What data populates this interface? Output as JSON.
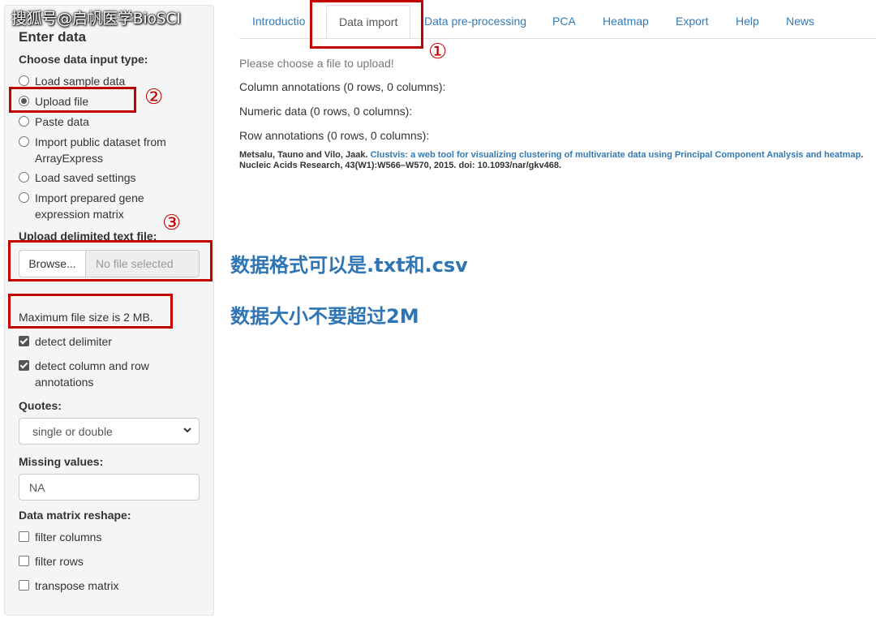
{
  "watermark": "搜狐号@启帆医学BioSCI",
  "sidebar": {
    "title": "Enter data",
    "input_type_label": "Choose data input type:",
    "input_options": [
      {
        "label": "Load sample data",
        "checked": false
      },
      {
        "label": "Upload file",
        "checked": true
      },
      {
        "label": "Paste data",
        "checked": false
      },
      {
        "label": "Import public dataset from ArrayExpress",
        "checked": false
      },
      {
        "label": "Load saved settings",
        "checked": false
      },
      {
        "label": "Import prepared gene expression matrix",
        "checked": false
      }
    ],
    "upload_label": "Upload delimited text file:",
    "browse_button": "Browse...",
    "file_placeholder": "No file selected",
    "max_size_note": "Maximum file size is 2 MB.",
    "detect_delimiter": {
      "label": "detect delimiter",
      "checked": true
    },
    "detect_annotations": {
      "label": "detect column and row annotations",
      "checked": true
    },
    "quotes_label": "Quotes:",
    "quotes_value": "single or double",
    "missing_label": "Missing values:",
    "missing_value": "NA",
    "reshape_label": "Data matrix reshape:",
    "reshape_options": [
      {
        "label": "filter columns",
        "checked": false
      },
      {
        "label": "filter rows",
        "checked": false
      },
      {
        "label": "transpose matrix",
        "checked": false
      }
    ]
  },
  "tabs": [
    {
      "label": "Introductio"
    },
    {
      "label": "Data import",
      "active": true
    },
    {
      "label": "Data pre-processing"
    },
    {
      "label": "PCA"
    },
    {
      "label": "Heatmap"
    },
    {
      "label": "Export"
    },
    {
      "label": "Help"
    },
    {
      "label": "News"
    }
  ],
  "main": {
    "choose_file": "Please choose a file to upload!",
    "column_annotations": "Column annotations (0 rows, 0 columns):",
    "numeric_data": "Numeric data (0 rows, 0 columns):",
    "row_annotations": "Row annotations (0 rows, 0 columns):",
    "citation_authors": "Metsalu, Tauno and Vilo, Jaak.",
    "citation_title": "Clustvis: a web tool for visualizing clustering of multivariate data using Principal Component Analysis and heatmap",
    "citation_rest": ". Nucleic Acids Research, 43(W1):W566–W570, 2015. doi: 10.1093/nar/gkv468."
  },
  "annotations": {
    "marker_1": "①",
    "marker_2": "②",
    "marker_3": "③",
    "note_format": "数据格式可以是.txt和.csv",
    "note_size": "数据大小不要超过2M",
    "box_color": "#c00000",
    "note_color": "#2e75b6"
  },
  "colors": {
    "link": "#337ab7",
    "sidebar_bg": "#f5f5f5"
  }
}
